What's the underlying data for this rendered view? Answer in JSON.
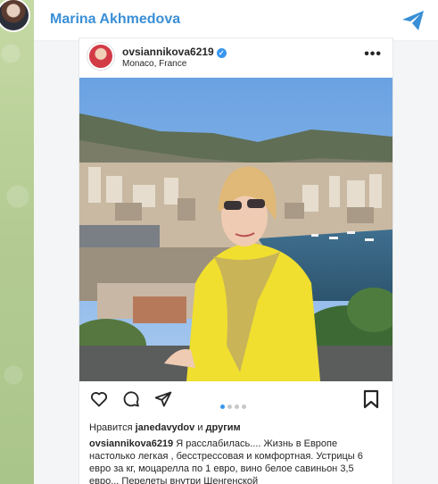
{
  "channel": {
    "name": "Marina Akhmedova"
  },
  "post": {
    "username": "ovsiannikova6219",
    "location": "Monaco, France",
    "more_glyph": "•••",
    "liked_by_prefix": "Нравится",
    "liked_by_user": "janedavydov",
    "liked_by_conj": "и",
    "liked_by_others": "другим",
    "caption_user": "ovsiannikova6219",
    "caption_text": "Я расслабилась.... Жизнь в Европе настолько легкая , бесстрессовая и комфортная. Устрицы 6 евро за кг, моцарелла по 1 евро, вино белое савиньон 3,5 евро... Перелеты внутри Шенгенской",
    "carousel_total": 4,
    "carousel_active": 1
  },
  "colors": {
    "channel_name": "#3a8fd6",
    "send_icon": "#3a8fd6",
    "verified": "#3897f0",
    "carousel_active": "#3897f0"
  },
  "icons": [
    "send-icon",
    "verified-icon",
    "more-icon",
    "heart-icon",
    "comment-icon",
    "share-icon",
    "bookmark-icon"
  ]
}
